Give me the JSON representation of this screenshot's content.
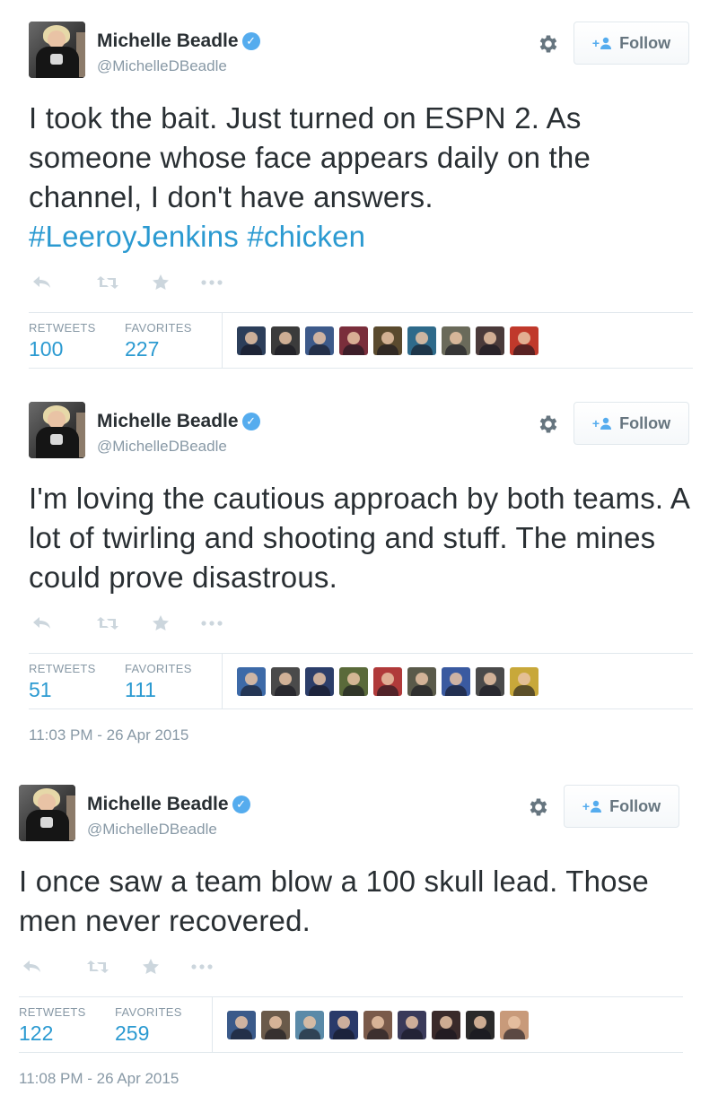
{
  "tweets": [
    {
      "author": {
        "name": "Michelle Beadle",
        "handle": "@MichelleDBeadle",
        "verified": true
      },
      "follow_label": "Follow",
      "text_plain": "I took the bait. Just turned on ESPN 2.  As someone whose face appears daily on the channel, I don't have answers. ",
      "hashtags": [
        "#LeeroyJenkins",
        "#chicken"
      ],
      "stats": {
        "retweets_label": "RETWEETS",
        "retweets": "100",
        "favorites_label": "FAVORITES",
        "favorites": "227"
      },
      "favoriter_colors": [
        "#2c3e5a",
        "#3b3b3b",
        "#3d5a8a",
        "#7a2e3b",
        "#5a4a2e",
        "#2e6a8a",
        "#6a6a5a",
        "#4a3a3a",
        "#c0392b"
      ],
      "timestamp": ""
    },
    {
      "author": {
        "name": "Michelle Beadle",
        "handle": "@MichelleDBeadle",
        "verified": true
      },
      "follow_label": "Follow",
      "text_plain": "I'm loving the cautious approach by both teams. A lot of twirling and shooting and stuff. The mines could prove disastrous.",
      "hashtags": [],
      "stats": {
        "retweets_label": "RETWEETS",
        "retweets": "51",
        "favorites_label": "FAVORITES",
        "favorites": "111"
      },
      "favoriter_colors": [
        "#3d6aa8",
        "#4a4a4a",
        "#2c3e6a",
        "#5a6a3a",
        "#b03a3a",
        "#5a5a4a",
        "#3a5aa0",
        "#4a4a4a",
        "#c8a83a"
      ],
      "timestamp": "11:03 PM - 26 Apr 2015"
    },
    {
      "author": {
        "name": "Michelle Beadle",
        "handle": "@MichelleDBeadle",
        "verified": true
      },
      "follow_label": "Follow",
      "text_plain": "I once saw a team blow a 100 skull lead. Those men never recovered.",
      "hashtags": [],
      "stats": {
        "retweets_label": "RETWEETS",
        "retweets": "122",
        "favorites_label": "FAVORITES",
        "favorites": "259"
      },
      "favoriter_colors": [
        "#3a5a8a",
        "#6a5a4a",
        "#5a8aa8",
        "#2a3a6a",
        "#7a5a4a",
        "#3a3a5a",
        "#3a2a2a",
        "#2a2a2a",
        "#c89a7a"
      ],
      "timestamp": "11:08 PM - 26 Apr 2015"
    }
  ]
}
